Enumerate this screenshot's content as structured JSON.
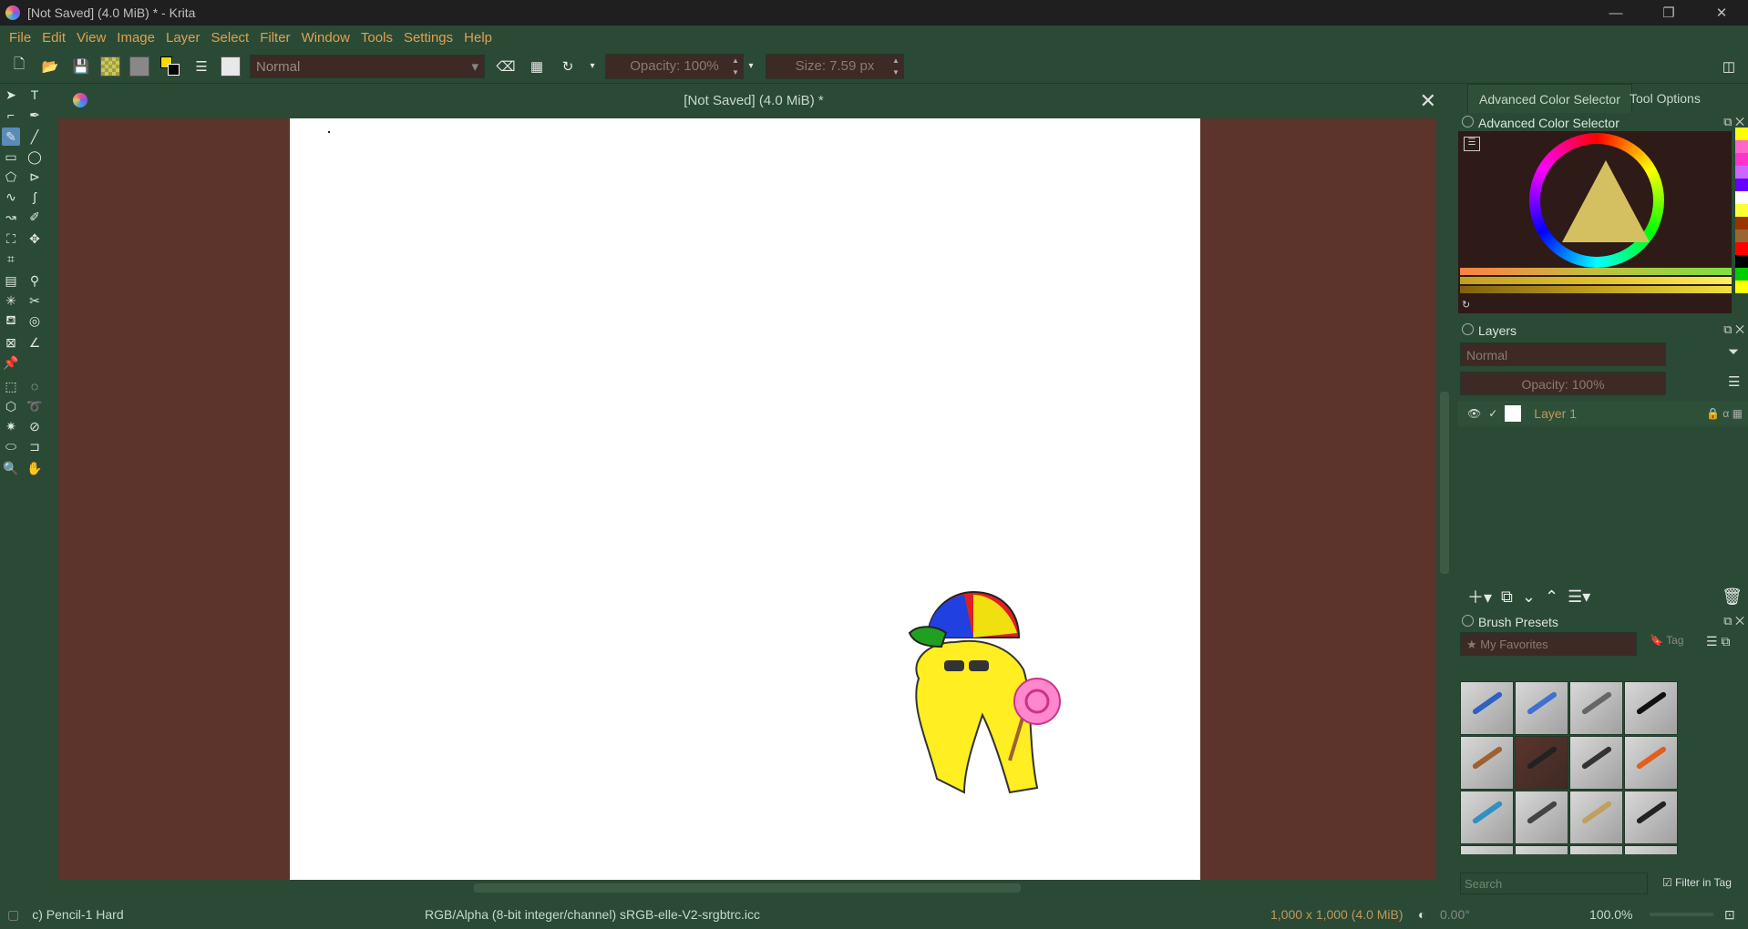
{
  "window": {
    "title": "[Not Saved]  (4.0 MiB) * - Krita",
    "minimize": "—",
    "restore": "❐",
    "close": "✕"
  },
  "menu": [
    "File",
    "Edit",
    "View",
    "Image",
    "Layer",
    "Select",
    "Filter",
    "Window",
    "Tools",
    "Settings",
    "Help"
  ],
  "toolbar": {
    "blend_mode": "Normal",
    "opacity": "Opacity: 100%",
    "size": "Size: 7.59 px"
  },
  "document": {
    "tab_title": "[Not Saved]  (4.0 MiB) *"
  },
  "right_panel": {
    "tabs": [
      "Advanced Color Selector",
      "Tool Options"
    ],
    "color_selector_title": "Advanced Color Selector",
    "layers_title": "Layers",
    "layers_blend": "Normal",
    "layers_opacity": "Opacity:  100%",
    "layer_name": "Layer 1",
    "brush_presets_title": "Brush Presets",
    "brush_tag": "My Favorites",
    "tag_button": "Tag",
    "search_placeholder": "Search",
    "filter_in_tag": "Filter in Tag"
  },
  "status": {
    "brush": "c) Pencil-1 Hard",
    "color_space": "RGB/Alpha (8-bit integer/channel)  sRGB-elle-V2-srgbtrc.icc",
    "image_size": "1,000 x 1,000 (4.0 MiB)",
    "rotation": "0.00°",
    "zoom": "100.0%"
  },
  "colors": {
    "accent_menu": "#e0a050",
    "panel_bg": "#2a4a35",
    "canvas_bg": "#5c342c",
    "field_bg": "#3d2a24"
  },
  "swatches": [
    "#ffff00",
    "#ff66cc",
    "#ff33cc",
    "#cc66ff",
    "#6600ff",
    "#ffffff",
    "#ffff33",
    "#993300",
    "#996633",
    "#ff0000",
    "#000000",
    "#00cc00",
    "#ffff00",
    "#000000"
  ],
  "shade_bars": [
    "#ff8040",
    "#e0c030",
    "#c0a020"
  ]
}
